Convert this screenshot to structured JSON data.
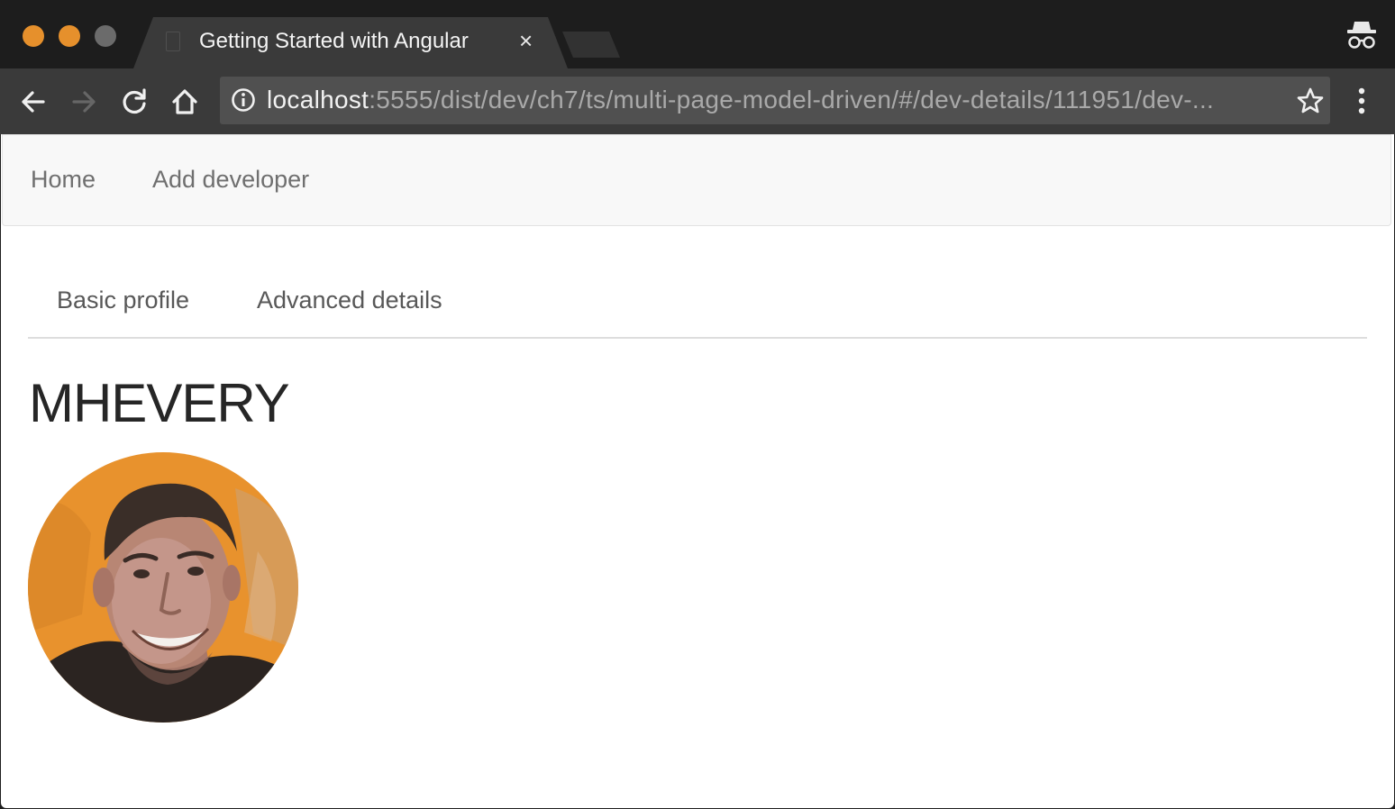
{
  "browser": {
    "tab_title": "Getting Started with Angular",
    "tab_close_glyph": "×",
    "url_host": "localhost",
    "url_path": ":5555/dist/dev/ch7/ts/multi-page-model-driven/#/dev-details/111951/dev-...",
    "traffic_light_colors": [
      "#e6902c",
      "#e6902c",
      "#6b6b6b"
    ],
    "icons": [
      "back-arrow-icon",
      "forward-arrow-icon",
      "reload-icon",
      "home-icon",
      "info-icon",
      "star-icon",
      "menu-icon",
      "incognito-icon",
      "document-icon"
    ]
  },
  "navbar": {
    "home_label": "Home",
    "add_developer_label": "Add developer"
  },
  "tabs": [
    {
      "label": "Basic profile"
    },
    {
      "label": "Advanced details"
    }
  ],
  "profile": {
    "name": "MHEVERY",
    "avatar_background": "#e8922d"
  }
}
